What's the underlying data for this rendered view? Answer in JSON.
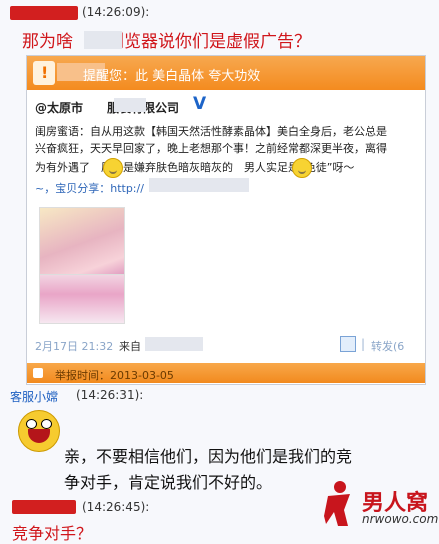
{
  "message1": {
    "time": "(14:26:09):",
    "question": "那为啥　　浏览器说你们是虚假广告？"
  },
  "card": {
    "warning": "提醒您：此 美白晶体 夸大功效",
    "brand": "@太原市　　服装有限公司",
    "body_lines": [
      "闺房蜜语：自从用这款【韩国天然活性酵素晶体】美白全身后，老公总是",
      "兴奋疯狂，天天早回家了，晚上老想那个事！之前经常都深更半夜，离得",
      "为有外遇了　原来是嫌弃肤色暗灰暗灰的　男人实足是“色徒”呀～",
      "~，宝贝分享：http://"
    ],
    "date": "2月17日 21:32",
    "from_label": "来自",
    "forward_label": "转发(6",
    "report": "举报时间：2013-03-05"
  },
  "message2": {
    "agent": "客服小嫦",
    "time": "(14:26:31):",
    "answer": "亲，不要相信他们，因为他们是我们的竞争对手，肯定说我们不好的。"
  },
  "message3": {
    "time": "(14:26:45):",
    "question": "竞争对手？"
  },
  "watermark": {
    "brand": "男人窝",
    "url": "nrwowo.com"
  }
}
